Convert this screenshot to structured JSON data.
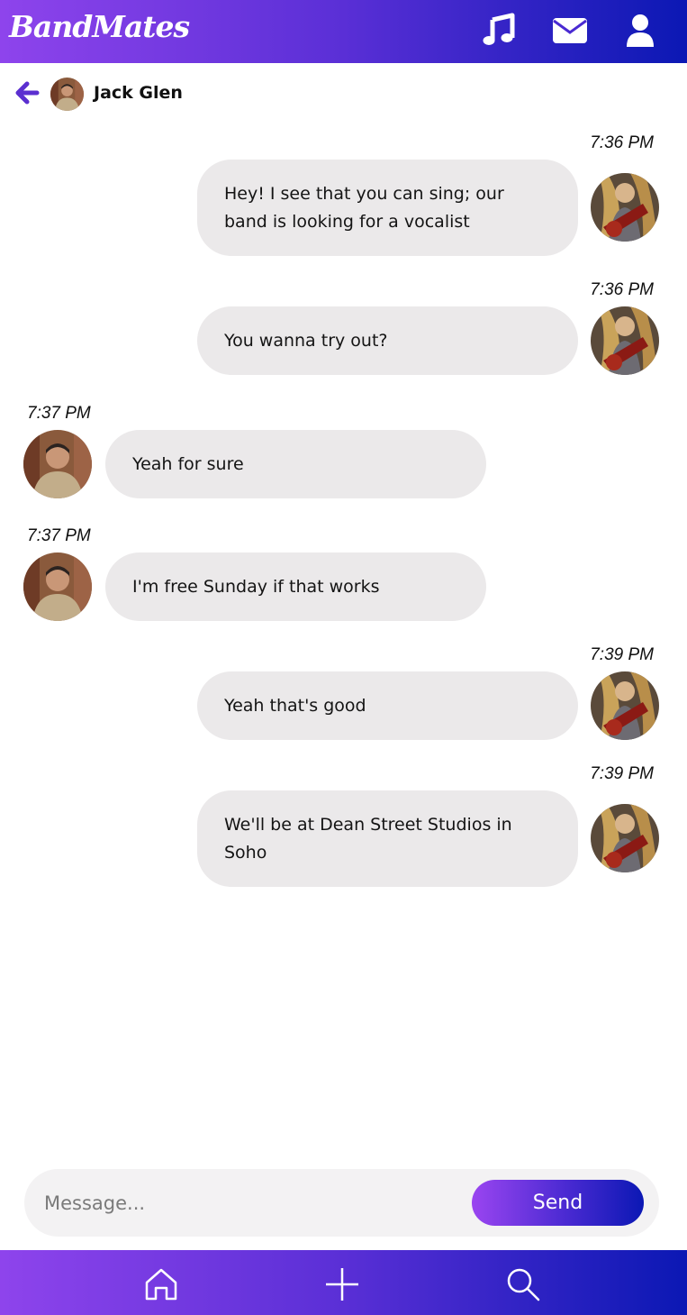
{
  "app": {
    "title": "BandMates"
  },
  "header_icons": [
    "music-note-icon",
    "envelope-icon",
    "user-icon"
  ],
  "chat": {
    "contact_name": "Jack Glen",
    "back_icon": "arrow-left-icon"
  },
  "messages": [
    {
      "direction": "sent",
      "time": "7:36 PM",
      "text": "Hey! I see that you can sing; our band is looking for a vocalist"
    },
    {
      "direction": "sent",
      "time": "7:36 PM",
      "text": "You wanna try out?"
    },
    {
      "direction": "received",
      "time": "7:37 PM",
      "text": "Yeah for sure"
    },
    {
      "direction": "received",
      "time": "7:37 PM",
      "text": "I'm free Sunday if that works"
    },
    {
      "direction": "sent",
      "time": "7:39 PM",
      "text": "Yeah that's good"
    },
    {
      "direction": "sent",
      "time": "7:39 PM",
      "text": "We'll be at Dean Street Studios in Soho"
    }
  ],
  "composer": {
    "placeholder": "Message...",
    "value": "",
    "send_label": "Send"
  },
  "bottom_nav": [
    "home-icon",
    "plus-icon",
    "search-icon"
  ],
  "colors": {
    "gradient_start": "#8e44ec",
    "gradient_end": "#0b18b4",
    "bubble": "#ebe9ea",
    "back_arrow": "#5b2fd0"
  }
}
